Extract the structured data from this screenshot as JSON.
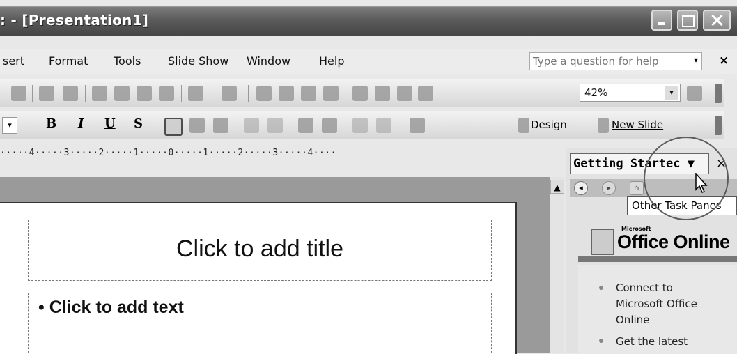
{
  "window": {
    "title": ": - [Presentation1]"
  },
  "menu": {
    "items": [
      "sert",
      "Format",
      "Tools",
      "Slide Show",
      "Window",
      "Help"
    ],
    "help_placeholder": "Type a question for help",
    "close": "×"
  },
  "toolbar": {
    "zoom": "42%",
    "bold": "B",
    "italic": "I",
    "underline": "U",
    "shadow": "S",
    "design": "Design",
    "new_slide": "New Slide"
  },
  "ruler": {
    "text": "·····4·····3·····2·····1·····0·····1·····2·····3·····4····"
  },
  "slide": {
    "title_placeholder": "Click to add title",
    "body_placeholder": "• Click to add text"
  },
  "taskpane": {
    "title": "Getting Startec",
    "close": "×",
    "tooltip": "Other Task Panes",
    "logo_small": "Microsoft",
    "logo_big": "Office Online",
    "links": [
      "Connect to",
      "Microsoft Office",
      "Online",
      "Get the latest"
    ]
  },
  "colors": {
    "highlight_circle": "#e33333"
  }
}
